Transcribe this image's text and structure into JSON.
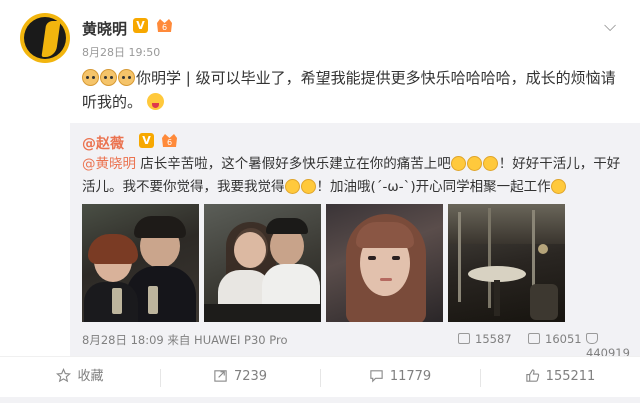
{
  "post": {
    "author": "黄晓明",
    "verified_badge": "V",
    "timestamp": "8月28日 19:50",
    "text": "你明学 | 级可以毕业了，希望我能提供更多快乐哈哈哈哈，成长的烦恼请听我的。",
    "emoji_prefix_count": 3
  },
  "repost": {
    "author": "@赵薇",
    "verified_badge": "V",
    "mention": "@黄晓明",
    "text_part1": " 店长辛苦啦，这个暑假好多快乐建立在你的痛苦上吧",
    "text_part2": "！好好干活儿，干好活儿。我不要你觉得，我要我觉得",
    "text_part3": "！加油哦(´-ω-`)开心同学相聚一起工作",
    "meta": "8月28日 18:09 来自 HUAWEI P30 Pro",
    "stats": {
      "reposts": "15587",
      "comments": "16051",
      "likes": "440919"
    }
  },
  "actions": {
    "favorite": "收藏",
    "repost": "7239",
    "comment": "11779",
    "like": "155211"
  },
  "colors": {
    "accent": "#eb7350",
    "verified": "#f7a800",
    "repost_bg": "#f2f2f5"
  }
}
